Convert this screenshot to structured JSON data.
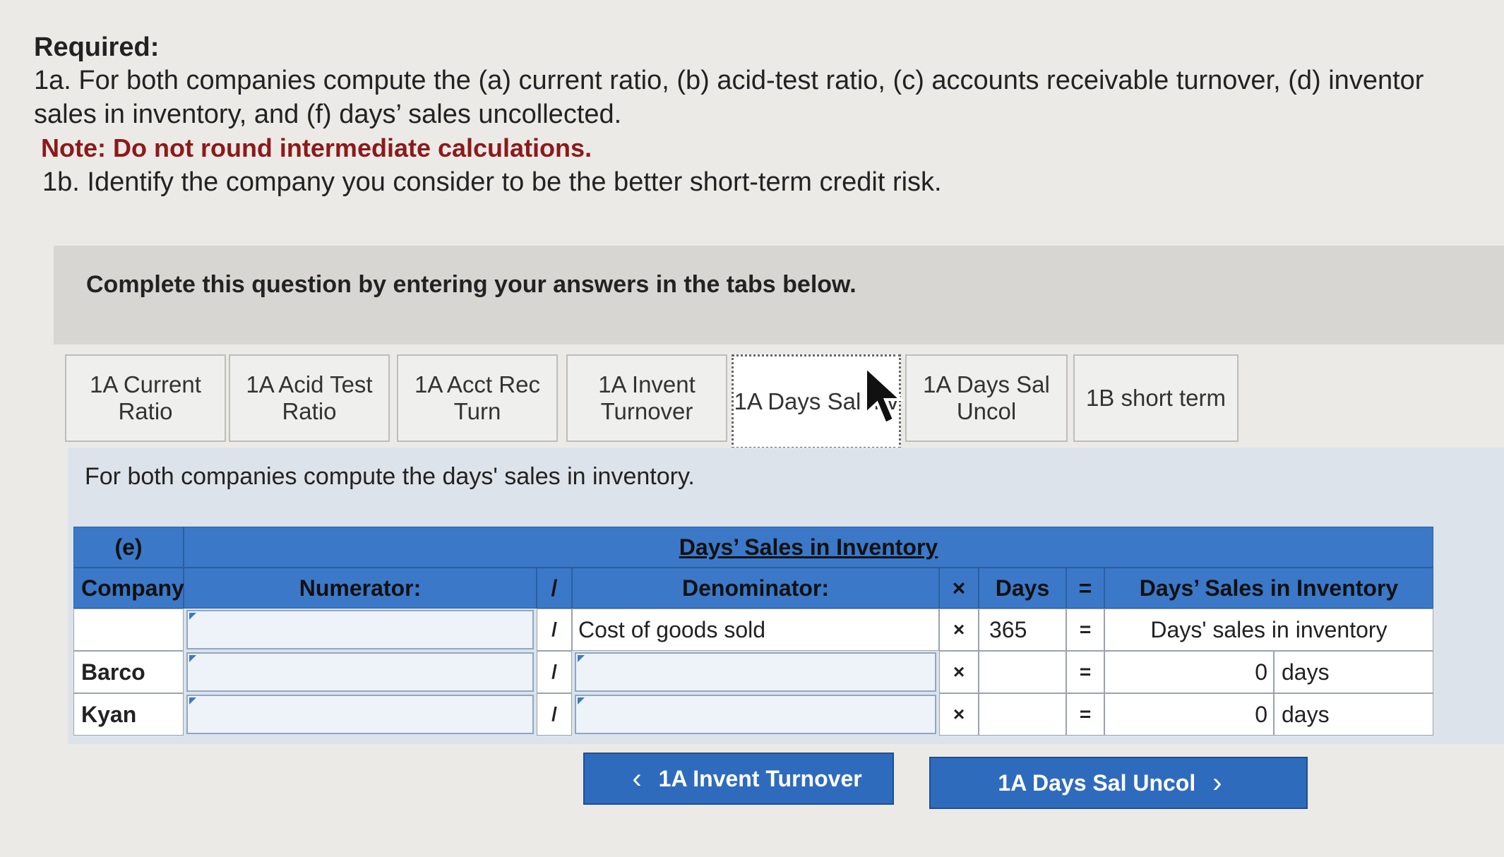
{
  "required": {
    "title": "Required:",
    "line1": "1a. For both companies compute the (a) current ratio, (b) acid-test ratio, (c) accounts receivable turnover, (d) inventor",
    "line2": "sales in inventory, and (f) days’ sales uncollected.",
    "note": "Note: Do not round intermediate calculations.",
    "line3": "1b. Identify the company you consider to be the better short-term credit risk."
  },
  "banner": "Complete this question by entering your answers in the tabs below.",
  "tabs": [
    {
      "label": "1A Current Ratio",
      "active": false
    },
    {
      "label": "1A Acid Test Ratio",
      "active": false
    },
    {
      "label": "1A Acct Rec Turn",
      "active": false
    },
    {
      "label": "1A Invent Turnover",
      "active": false
    },
    {
      "label": "1A Days Sal Inv",
      "active": true
    },
    {
      "label": "1A Days Sal Uncol",
      "active": false
    },
    {
      "label": "1B short term",
      "active": false
    }
  ],
  "panel": {
    "instruction": "For both companies compute the days' sales in inventory."
  },
  "table": {
    "part": "(e)",
    "title": "Days’ Sales in Inventory",
    "headers": {
      "company": "Company",
      "numerator": "Numerator:",
      "slash": "/",
      "denominator": "Denominator:",
      "times": "×",
      "days": "Days",
      "equals": "=",
      "result": "Days’ Sales in Inventory"
    },
    "rows": [
      {
        "company": "",
        "numerator": "",
        "denominator": "Cost of goods sold",
        "days": "365",
        "result_value": "Days' sales in inventory",
        "result_unit": ""
      },
      {
        "company": "Barco",
        "numerator": "",
        "denominator": "",
        "days": "",
        "result_value": "0",
        "result_unit": "days"
      },
      {
        "company": "Kyan",
        "numerator": "",
        "denominator": "",
        "days": "",
        "result_value": "0",
        "result_unit": "days"
      }
    ]
  },
  "nav": {
    "prev_label": "1A Invent Turnover",
    "next_label": "1A Days Sal Uncol"
  },
  "colors": {
    "header_blue": "#3b78c8",
    "note_red": "#8b1a1a",
    "button_blue": "#2f6bbd"
  }
}
